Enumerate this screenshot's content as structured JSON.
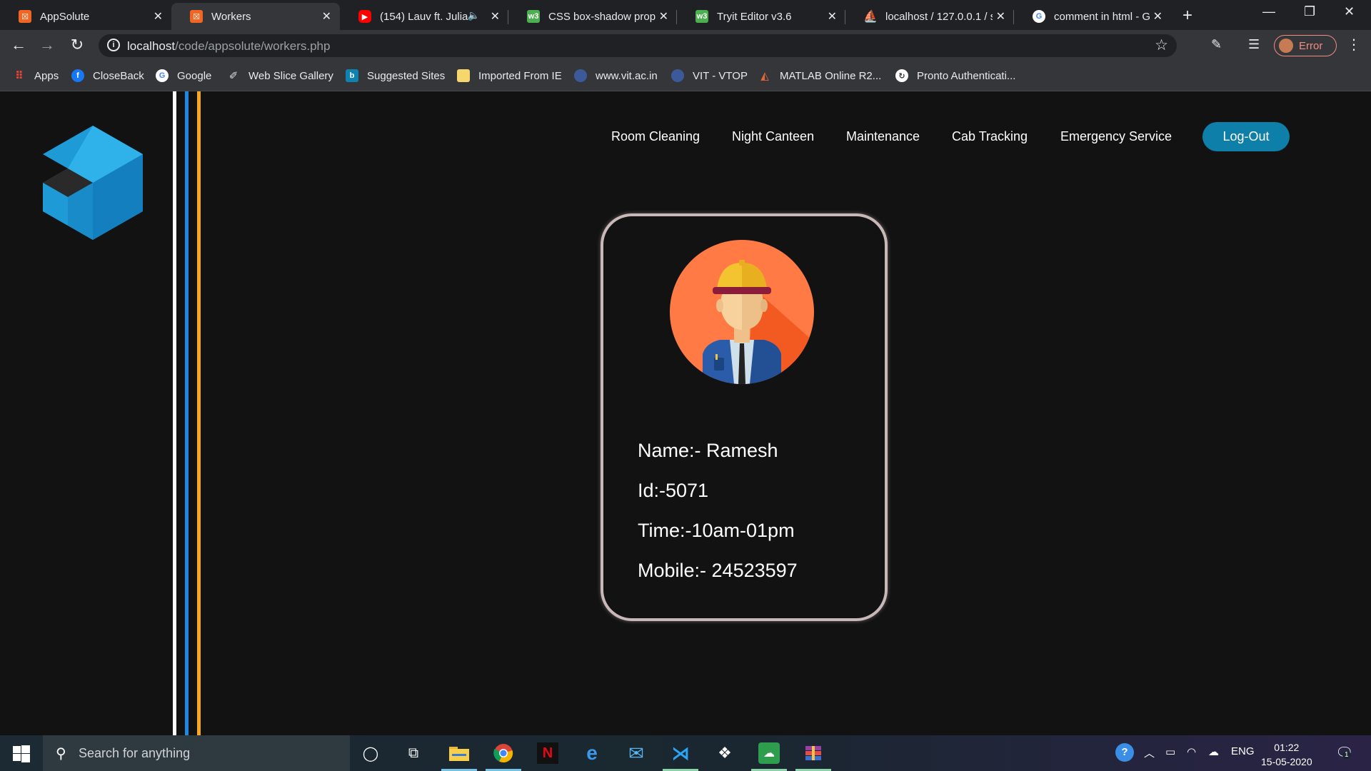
{
  "browser": {
    "tabs": [
      {
        "title": "AppSolute",
        "icon": "xampp-icon",
        "color": "#f26522",
        "active": false
      },
      {
        "title": "Workers",
        "icon": "xampp-icon",
        "color": "#f26522",
        "active": true
      },
      {
        "title": "(154) Lauv ft. Julia",
        "icon": "youtube-icon",
        "color": "#ff0000",
        "active": false
      },
      {
        "title": "CSS box-shadow prope",
        "icon": "w3schools-icon",
        "color": "#4caf50",
        "active": false
      },
      {
        "title": "Tryit Editor v3.6",
        "icon": "w3schools-icon",
        "color": "#4caf50",
        "active": false
      },
      {
        "title": "localhost / 127.0.0.1 / s",
        "icon": "phpmyadmin-icon",
        "color": "#f0a030",
        "active": false
      },
      {
        "title": "comment in html - Goo",
        "icon": "google-icon",
        "color": "#ffffff",
        "active": false
      }
    ],
    "url_host": "localhost",
    "url_path": "/code/appsolute/workers.php",
    "profile_label": "Error",
    "bookmarks": [
      {
        "label": "Apps",
        "icon": "apps-grid-icon",
        "color": "#ea4335"
      },
      {
        "label": "CloseBack",
        "icon": "facebook-icon",
        "color": "#1877f2"
      },
      {
        "label": "Google",
        "icon": "google-icon",
        "color": "#ffffff"
      },
      {
        "label": "Web Slice Gallery",
        "icon": "web-slice-icon",
        "color": "#dddddd"
      },
      {
        "label": "Suggested Sites",
        "icon": "bing-icon",
        "color": "#0f82b0"
      },
      {
        "label": "Imported From IE",
        "icon": "folder-icon",
        "color": "#f5d76e"
      },
      {
        "label": "www.vit.ac.in",
        "icon": "vit-icon",
        "color": "#3c5a9a"
      },
      {
        "label": "VIT - VTOP",
        "icon": "vit-icon",
        "color": "#3c5a9a"
      },
      {
        "label": "MATLAB Online R2...",
        "icon": "matlab-icon",
        "color": "#e16737"
      },
      {
        "label": "Pronto Authenticati...",
        "icon": "pronto-icon",
        "color": "#ffffff"
      }
    ]
  },
  "site": {
    "nav": [
      "Room Cleaning",
      "Night Canteen",
      "Maintenance",
      "Cab Tracking",
      "Emergency Service"
    ],
    "logout_label": "Log-Out",
    "stripe_colors": [
      "#ffffff",
      "#1e88e5",
      "#f5a623"
    ]
  },
  "worker": {
    "name": "Name:- Ramesh",
    "id": "Id:-5071",
    "time": "Time:-10am-01pm",
    "mobile": "Mobile:- 24523597"
  },
  "taskbar": {
    "search_placeholder": "Search for anything",
    "language": "ENG",
    "time": "01:22",
    "date": "15-05-2020",
    "notification_count": "1"
  }
}
